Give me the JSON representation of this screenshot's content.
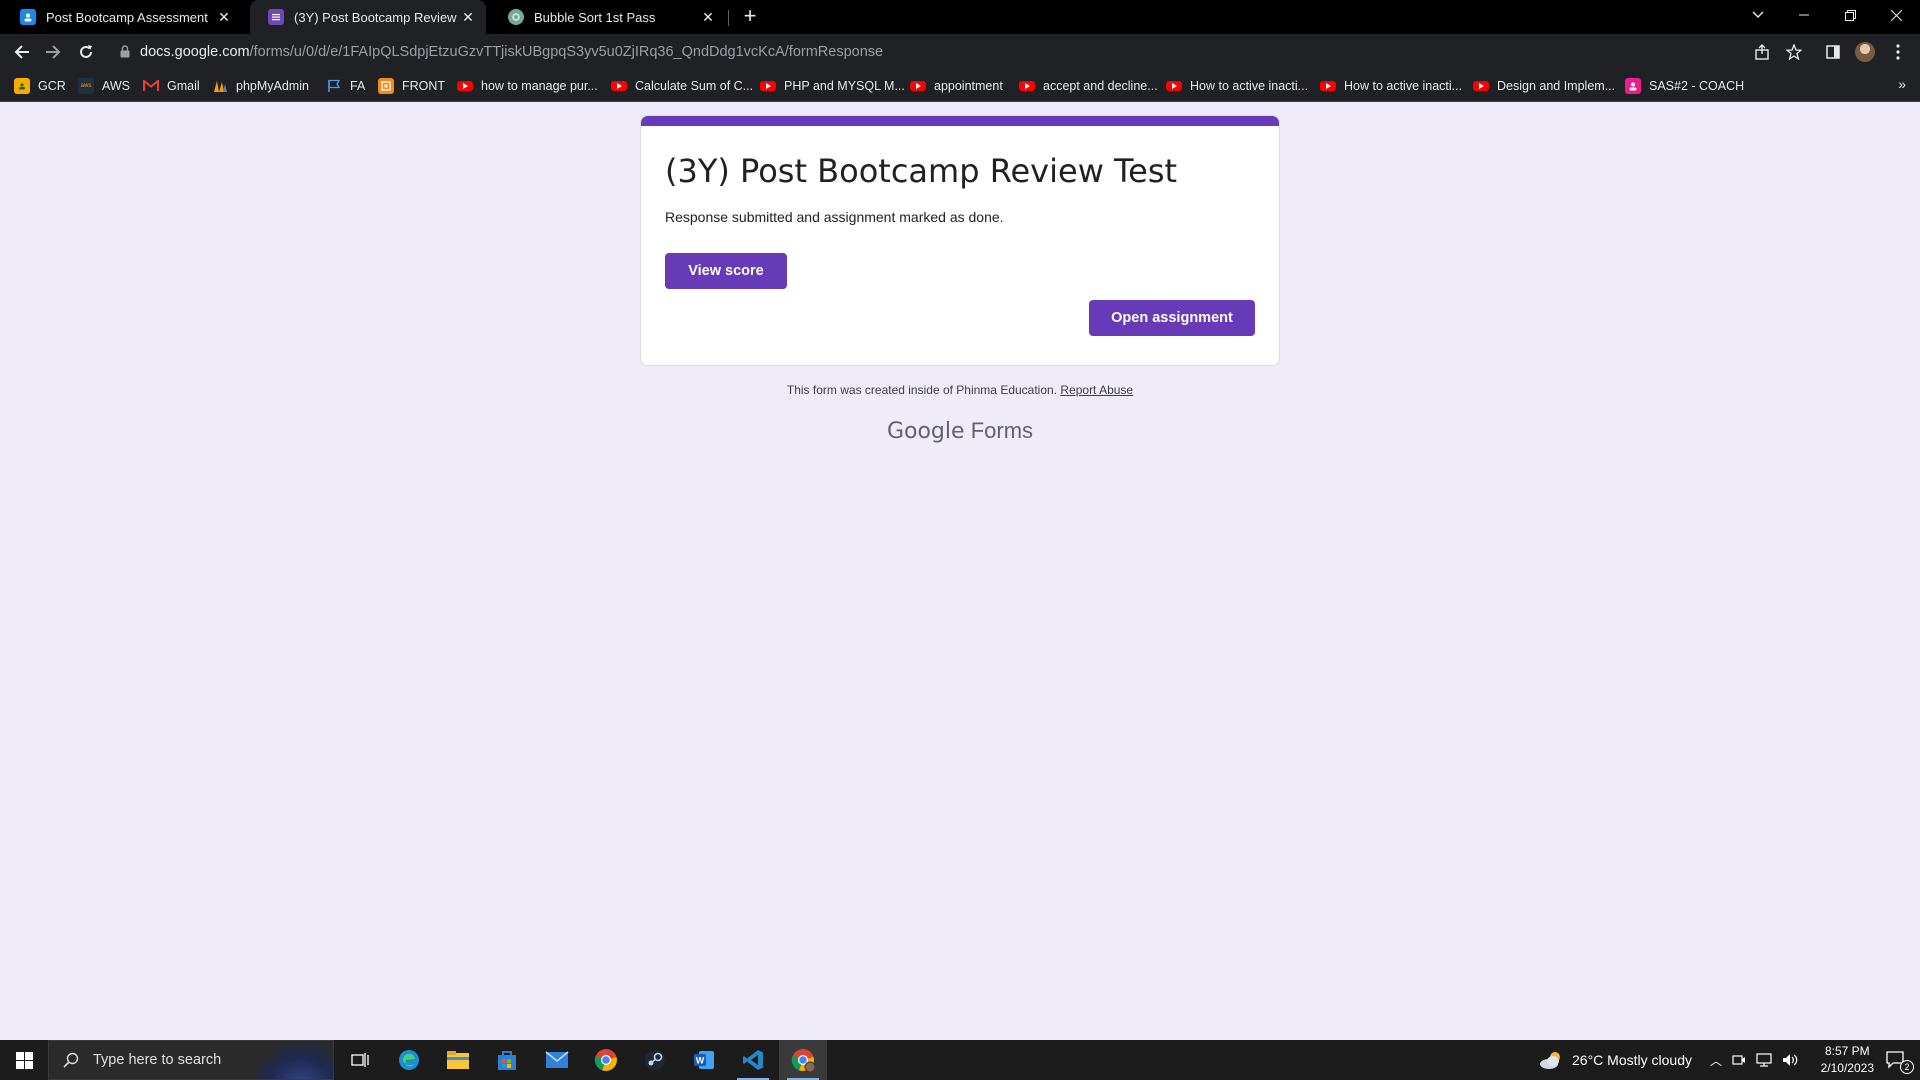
{
  "browser": {
    "tabs": [
      {
        "title": "Post Bootcamp Assessment",
        "icon": "google-classroom-icon",
        "active": false
      },
      {
        "title": "(3Y) Post Bootcamp Review Test",
        "icon": "google-forms-icon",
        "active": true
      },
      {
        "title": "Bubble Sort 1st Pass",
        "icon": "chatgpt-icon",
        "active": false
      }
    ],
    "url_host": "docs.google.com",
    "url_path": "/forms/u/0/d/e/1FAIpQLSdpjEtzuGzvTTjiskUBgpqS3yv5u0ZjIRq36_QndDdg1vcKcA/formResponse",
    "bookmarks": [
      {
        "label": "GCR",
        "icon": "google-classroom-icon"
      },
      {
        "label": "AWS",
        "icon": "aws-icon"
      },
      {
        "label": "Gmail",
        "icon": "gmail-icon"
      },
      {
        "label": "phpMyAdmin",
        "icon": "phpmyadmin-icon"
      },
      {
        "label": "FA",
        "icon": "flag-icon"
      },
      {
        "label": "FRONT",
        "icon": "front-icon"
      },
      {
        "label": "how to manage pur...",
        "icon": "youtube-icon"
      },
      {
        "label": "Calculate Sum of C...",
        "icon": "youtube-icon"
      },
      {
        "label": "PHP and MYSQL M...",
        "icon": "youtube-icon"
      },
      {
        "label": "appointment",
        "icon": "youtube-icon"
      },
      {
        "label": "accept and decline...",
        "icon": "youtube-icon"
      },
      {
        "label": "How to active inacti...",
        "icon": "youtube-icon"
      },
      {
        "label": "How to active inacti...",
        "icon": "youtube-icon"
      },
      {
        "label": "Design and Implem...",
        "icon": "youtube-icon"
      },
      {
        "label": "SAS#2 - COACH",
        "icon": "sas-icon"
      }
    ]
  },
  "form": {
    "title": "(3Y) Post Bootcamp Review Test",
    "message": "Response submitted and assignment marked as done.",
    "view_score_label": "View score",
    "open_assignment_label": "Open assignment",
    "footer_text": "This form was created inside of Phinma Education.",
    "report_abuse_label": "Report Abuse",
    "brand_google": "Google",
    "brand_forms": "Forms",
    "accent_color": "#673ab7",
    "background_color": "#f0ebf8"
  },
  "taskbar": {
    "search_placeholder": "Type here to search",
    "pinned": [
      "task-view-icon",
      "edge-icon",
      "file-explorer-icon",
      "store-icon",
      "mail-icon",
      "chrome-icon",
      "steam-icon",
      "word-icon",
      "vscode-icon",
      "chrome-profile-icon"
    ],
    "weather": "26°C  Mostly cloudy",
    "time": "8:57 PM",
    "date": "2/10/2023",
    "notification_count": "2"
  }
}
